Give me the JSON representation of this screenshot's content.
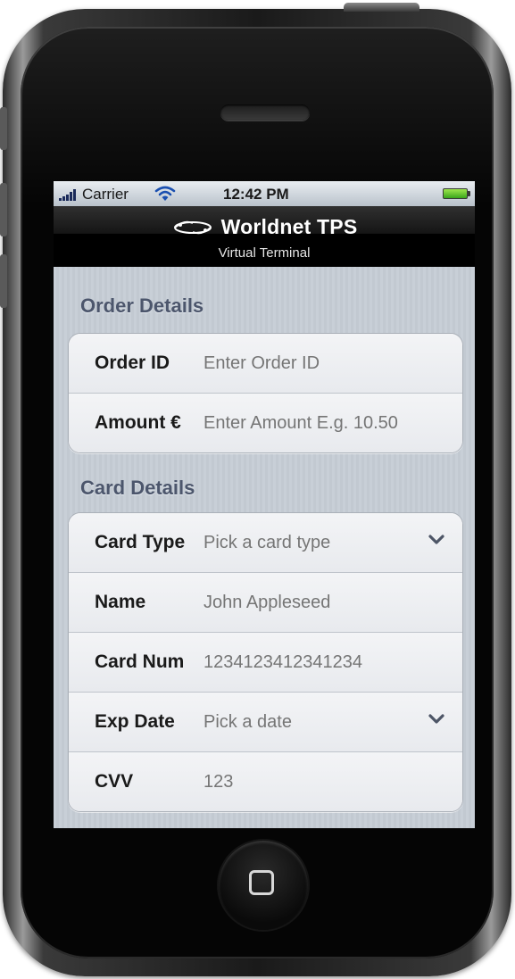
{
  "status_bar": {
    "carrier": "Carrier",
    "time": "12:42 PM",
    "icons": [
      "signal-icon",
      "wifi-icon",
      "battery-icon"
    ],
    "battery_color": "#5fd02f"
  },
  "nav_bar": {
    "title": "Worldnet TPS",
    "subtitle": "Virtual Terminal",
    "logo_icon": "worldnet-logo-icon"
  },
  "order_details": {
    "header": "Order Details",
    "fields": [
      {
        "label": "Order ID",
        "placeholder": "Enter Order ID",
        "value": ""
      },
      {
        "label": "Amount €",
        "placeholder": "Enter Amount E.g. 10.50",
        "value": ""
      }
    ]
  },
  "card_details": {
    "header": "Card Details",
    "fields": [
      {
        "label": "Card Type",
        "placeholder": "Pick a card type",
        "value": "",
        "icon": "chevron-down-icon"
      },
      {
        "label": "Name",
        "placeholder": "John Appleseed",
        "value": ""
      },
      {
        "label": "Card Num",
        "placeholder": "1234123412341234",
        "value": ""
      },
      {
        "label": "Exp Date",
        "placeholder": "Pick a date",
        "value": "",
        "icon": "chevron-down-icon"
      },
      {
        "label": "CVV",
        "placeholder": "123",
        "value": ""
      }
    ]
  },
  "device": {
    "home_icon": "home-button-icon"
  },
  "colors": {
    "section_header": "#4c566c",
    "placeholder": "#b0b4ba",
    "label": "#1a1a1a",
    "background": "#c5ccd4"
  }
}
